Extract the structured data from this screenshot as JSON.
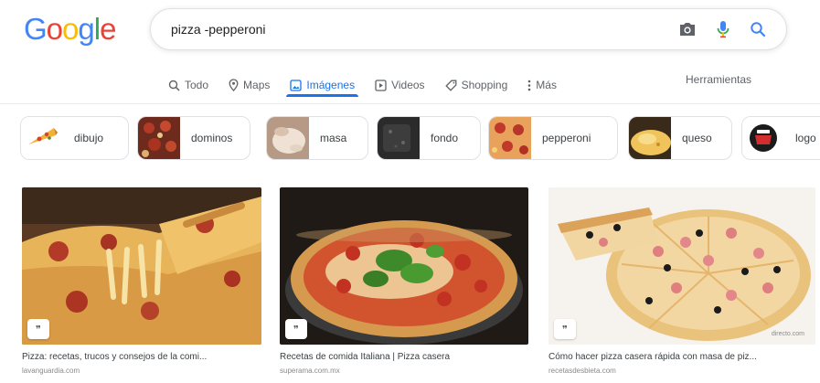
{
  "logo": {
    "letters": [
      "G",
      "o",
      "o",
      "g",
      "l",
      "e"
    ],
    "colors": [
      "#4285f4",
      "#ea4335",
      "#fbbc05",
      "#4285f4",
      "#34a853",
      "#ea4335"
    ]
  },
  "search": {
    "query": "pizza -pepperoni",
    "camera_icon": "camera-icon",
    "mic_icon": "mic-icon",
    "search_icon": "search-icon"
  },
  "tabs": [
    {
      "label": "Todo",
      "icon": "search-icon",
      "active": false
    },
    {
      "label": "Maps",
      "icon": "map-pin-icon",
      "active": false
    },
    {
      "label": "Imágenes",
      "icon": "image-icon",
      "active": true
    },
    {
      "label": "Videos",
      "icon": "video-icon",
      "active": false
    },
    {
      "label": "Shopping",
      "icon": "tag-icon",
      "active": false
    },
    {
      "label": "Más",
      "icon": "more-vert-icon",
      "active": false
    }
  ],
  "tools": "Herramientas",
  "chips": [
    {
      "label": "dibujo"
    },
    {
      "label": "dominos"
    },
    {
      "label": "masa"
    },
    {
      "label": "fondo"
    },
    {
      "label": "pepperoni"
    },
    {
      "label": "queso"
    },
    {
      "label": "logo"
    }
  ],
  "results": [
    {
      "title": "Pizza: recetas, trucos y consejos de la comi...",
      "source": "lavanguardia.com",
      "badge": "❞",
      "watermark": ""
    },
    {
      "title": "Recetas de comida Italiana | Pizza casera",
      "source": "superama.com.mx",
      "badge": "❞",
      "watermark": ""
    },
    {
      "title": "Cómo hacer pizza casera rápida con masa de piz...",
      "source": "recetasdesbieta.com",
      "badge": "❞",
      "watermark": "directo.com"
    }
  ],
  "colors": {
    "accent": "#1a73e8",
    "text_muted": "#5f6368",
    "border": "#dfe1e5"
  }
}
